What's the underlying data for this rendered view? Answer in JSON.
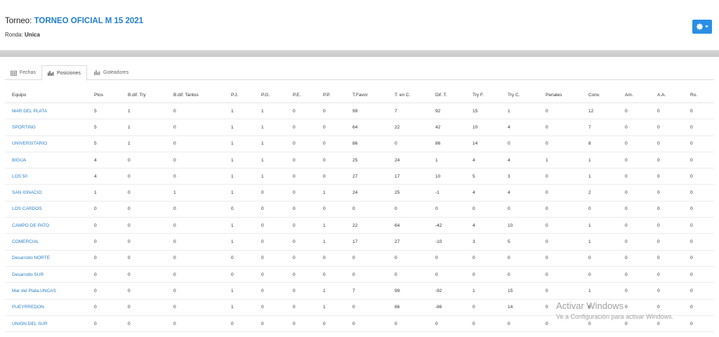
{
  "header": {
    "torneo_label": "Torneo: ",
    "torneo_name": "TORNEO OFICIAL M 15 2021",
    "ronda_label": "Ronda: ",
    "ronda_value": "Unica",
    "settings_icon": "gear-icon",
    "accent_color": "#2a8ee6"
  },
  "tabs": [
    {
      "label": "Fechas",
      "icon": "calendar-icon",
      "active": false
    },
    {
      "label": "Posiciones",
      "icon": "bar-chart-icon",
      "active": true
    },
    {
      "label": "Goleadores",
      "icon": "bar-chart-icon",
      "active": false
    }
  ],
  "table": {
    "columns": [
      "Equipo",
      "Ptos",
      "B.dif. Try",
      "B.dif. Tantos",
      "P.J.",
      "P.G.",
      "P.E.",
      "P.P.",
      "T.Favor",
      "T. en C.",
      "Dif. T.",
      "Try F.",
      "Try C.",
      "Penales",
      "Conv.",
      "Am.",
      "A.A.",
      "Ro."
    ],
    "rows": [
      [
        "MAR DEL PLATA",
        "5",
        "1",
        "0",
        "1",
        "1",
        "0",
        "0",
        "99",
        "7",
        "92",
        "15",
        "1",
        "0",
        "12",
        "0",
        "0",
        "0"
      ],
      [
        "SPORTING",
        "5",
        "1",
        "0",
        "1",
        "1",
        "0",
        "0",
        "64",
        "22",
        "42",
        "10",
        "4",
        "0",
        "7",
        "0",
        "0",
        "0"
      ],
      [
        "UNIVERSITARIO",
        "5",
        "1",
        "0",
        "1",
        "1",
        "0",
        "0",
        "86",
        "0",
        "86",
        "14",
        "0",
        "0",
        "8",
        "0",
        "0",
        "0"
      ],
      [
        "BIGUA",
        "4",
        "0",
        "0",
        "1",
        "1",
        "0",
        "0",
        "25",
        "24",
        "1",
        "4",
        "4",
        "1",
        "1",
        "0",
        "0",
        "0"
      ],
      [
        "LOS 50",
        "4",
        "0",
        "0",
        "1",
        "1",
        "0",
        "0",
        "27",
        "17",
        "10",
        "5",
        "3",
        "0",
        "1",
        "0",
        "0",
        "0"
      ],
      [
        "SAN IGNACIO",
        "1",
        "0",
        "1",
        "1",
        "0",
        "0",
        "1",
        "24",
        "25",
        "-1",
        "4",
        "4",
        "0",
        "2",
        "0",
        "0",
        "0"
      ],
      [
        "LOS CARDOS",
        "0",
        "0",
        "0",
        "0",
        "0",
        "0",
        "0",
        "0",
        "0",
        "0",
        "0",
        "0",
        "0",
        "0",
        "0",
        "0",
        "0"
      ],
      [
        "CAMPO DE PATO",
        "0",
        "0",
        "0",
        "1",
        "0",
        "0",
        "1",
        "22",
        "64",
        "-42",
        "4",
        "10",
        "0",
        "1",
        "0",
        "0",
        "0"
      ],
      [
        "COMERCIAL",
        "0",
        "0",
        "0",
        "1",
        "0",
        "0",
        "1",
        "17",
        "27",
        "-10",
        "3",
        "5",
        "0",
        "1",
        "0",
        "0",
        "0"
      ],
      [
        "Desarrollo NORTE",
        "0",
        "0",
        "0",
        "0",
        "0",
        "0",
        "0",
        "0",
        "0",
        "0",
        "0",
        "0",
        "0",
        "0",
        "0",
        "0",
        "0"
      ],
      [
        "Desarrollo SUR",
        "0",
        "0",
        "0",
        "0",
        "0",
        "0",
        "0",
        "0",
        "0",
        "0",
        "0",
        "0",
        "0",
        "0",
        "0",
        "0",
        "0"
      ],
      [
        "Mar del Plata UNCAS",
        "0",
        "0",
        "0",
        "1",
        "0",
        "0",
        "1",
        "7",
        "99",
        "-92",
        "1",
        "15",
        "0",
        "1",
        "0",
        "0",
        "0"
      ],
      [
        "PUEYRREDON",
        "0",
        "0",
        "0",
        "1",
        "0",
        "0",
        "1",
        "0",
        "86",
        "-86",
        "0",
        "14",
        "0",
        "0",
        "0",
        "0",
        "0"
      ],
      [
        "UNION DEL SUR",
        "0",
        "0",
        "0",
        "0",
        "0",
        "0",
        "0",
        "0",
        "0",
        "0",
        "0",
        "0",
        "0",
        "0",
        "0",
        "0",
        "0"
      ]
    ]
  },
  "watermark": {
    "title": "Activar Windows",
    "subtitle": "Ve a Configuración para activar Windows."
  }
}
